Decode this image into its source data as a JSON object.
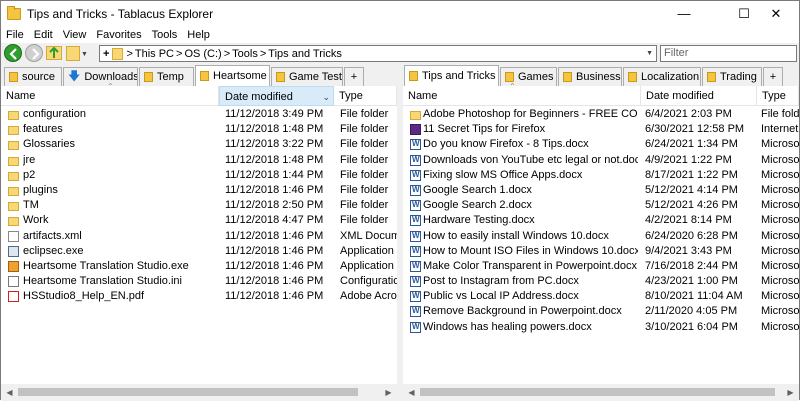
{
  "window": {
    "title": "Tips and Tricks - Tablacus Explorer"
  },
  "menu": [
    "File",
    "Edit",
    "View",
    "Favorites",
    "Tools",
    "Help"
  ],
  "address": {
    "plus": "+",
    "path": [
      "This PC",
      "OS (C:)",
      "Tools",
      "Tips and Tricks"
    ],
    "sep": ">"
  },
  "filter": {
    "placeholder": "Filter"
  },
  "left": {
    "tabs": [
      {
        "label": "source"
      },
      {
        "label": "Downloads"
      },
      {
        "label": "Temp"
      },
      {
        "label": "Heartsome"
      },
      {
        "label": "Game Test"
      },
      {
        "label": "+"
      }
    ],
    "columns": [
      "Name",
      "Date modified",
      "Type"
    ],
    "rows": [
      {
        "icon": "folder",
        "name": "configuration",
        "date": "11/12/2018 3:49 PM",
        "type": "File folder"
      },
      {
        "icon": "folder",
        "name": "features",
        "date": "11/12/2018 1:48 PM",
        "type": "File folder"
      },
      {
        "icon": "folder",
        "name": "Glossaries",
        "date": "11/12/2018 3:22 PM",
        "type": "File folder"
      },
      {
        "icon": "folder",
        "name": "jre",
        "date": "11/12/2018 1:48 PM",
        "type": "File folder"
      },
      {
        "icon": "folder",
        "name": "p2",
        "date": "11/12/2018 1:44 PM",
        "type": "File folder"
      },
      {
        "icon": "folder",
        "name": "plugins",
        "date": "11/12/2018 1:46 PM",
        "type": "File folder"
      },
      {
        "icon": "folder",
        "name": "TM",
        "date": "11/12/2018 2:50 PM",
        "type": "File folder"
      },
      {
        "icon": "folder",
        "name": "Work",
        "date": "11/12/2018 4:47 PM",
        "type": "File folder"
      },
      {
        "icon": "xml",
        "name": "artifacts.xml",
        "date": "11/12/2018 1:46 PM",
        "type": "XML Documen"
      },
      {
        "icon": "exe",
        "name": "eclipsec.exe",
        "date": "11/12/2018 1:46 PM",
        "type": "Application"
      },
      {
        "icon": "app",
        "name": "Heartsome Translation Studio.exe",
        "date": "11/12/2018 1:46 PM",
        "type": "Application"
      },
      {
        "icon": "ini",
        "name": "Heartsome Translation Studio.ini",
        "date": "11/12/2018 1:46 PM",
        "type": "Configuration"
      },
      {
        "icon": "pdf",
        "name": "HSStudio8_Help_EN.pdf",
        "date": "11/12/2018 1:46 PM",
        "type": "Adobe Acroba"
      }
    ]
  },
  "right": {
    "tabs": [
      {
        "label": "Tips and Tricks"
      },
      {
        "label": "Games"
      },
      {
        "label": "Business"
      },
      {
        "label": "Localization"
      },
      {
        "label": "Trading"
      },
      {
        "label": "+"
      }
    ],
    "columns": [
      "Name",
      "Date modified",
      "Type"
    ],
    "rows": [
      {
        "icon": "folder",
        "name": "Adobe Photoshop for Beginners - FREE COURSE",
        "date": "6/4/2021 2:03 PM",
        "type": "File folde"
      },
      {
        "icon": "url",
        "name": "11 Secret Tips for Firefox",
        "date": "6/30/2021 12:58 PM",
        "type": "Internet S"
      },
      {
        "icon": "doc",
        "name": "Do you know Firefox - 8 Tips.docx",
        "date": "6/24/2021 1:34 PM",
        "type": "Microsoft"
      },
      {
        "icon": "doc",
        "name": "Downloads von YouTube etc legal or not.docx",
        "date": "4/9/2021 1:22 PM",
        "type": "Microsoft"
      },
      {
        "icon": "doc",
        "name": "Fixing slow MS Office Apps.docx",
        "date": "8/17/2021 1:22 PM",
        "type": "Microsoft"
      },
      {
        "icon": "doc",
        "name": "Google Search 1.docx",
        "date": "5/12/2021 4:14 PM",
        "type": "Microsoft"
      },
      {
        "icon": "doc",
        "name": "Google Search 2.docx",
        "date": "5/12/2021 4:26 PM",
        "type": "Microsoft"
      },
      {
        "icon": "doc",
        "name": "Hardware Testing.docx",
        "date": "4/2/2021 8:14 PM",
        "type": "Microsoft"
      },
      {
        "icon": "doc",
        "name": "How to easily install Windows 10.docx",
        "date": "6/24/2020 6:28 PM",
        "type": "Microsoft"
      },
      {
        "icon": "doc",
        "name": "How to Mount ISO Files in Windows 10.docx",
        "date": "9/4/2021 3:43 PM",
        "type": "Microsoft"
      },
      {
        "icon": "doc",
        "name": "Make Color Transparent in Powerpoint.docx",
        "date": "7/16/2018 2:44 PM",
        "type": "Microsoft"
      },
      {
        "icon": "doc",
        "name": "Post to Instagram from PC.docx",
        "date": "4/23/2021 1:00 PM",
        "type": "Microsoft"
      },
      {
        "icon": "doc",
        "name": "Public vs Local IP Address.docx",
        "date": "8/10/2021 11:04 AM",
        "type": "Microsoft"
      },
      {
        "icon": "doc",
        "name": "Remove Background in Powerpoint.docx",
        "date": "2/11/2020 4:05 PM",
        "type": "Microsoft"
      },
      {
        "icon": "doc",
        "name": "Windows has healing powers.docx",
        "date": "3/10/2021 6:04 PM",
        "type": "Microsoft"
      }
    ]
  },
  "colors": {
    "accent": "#0078d7",
    "folder": "#f8d775",
    "selected_tab": "#ffffff",
    "sorted_header": "#d9ebf9"
  }
}
